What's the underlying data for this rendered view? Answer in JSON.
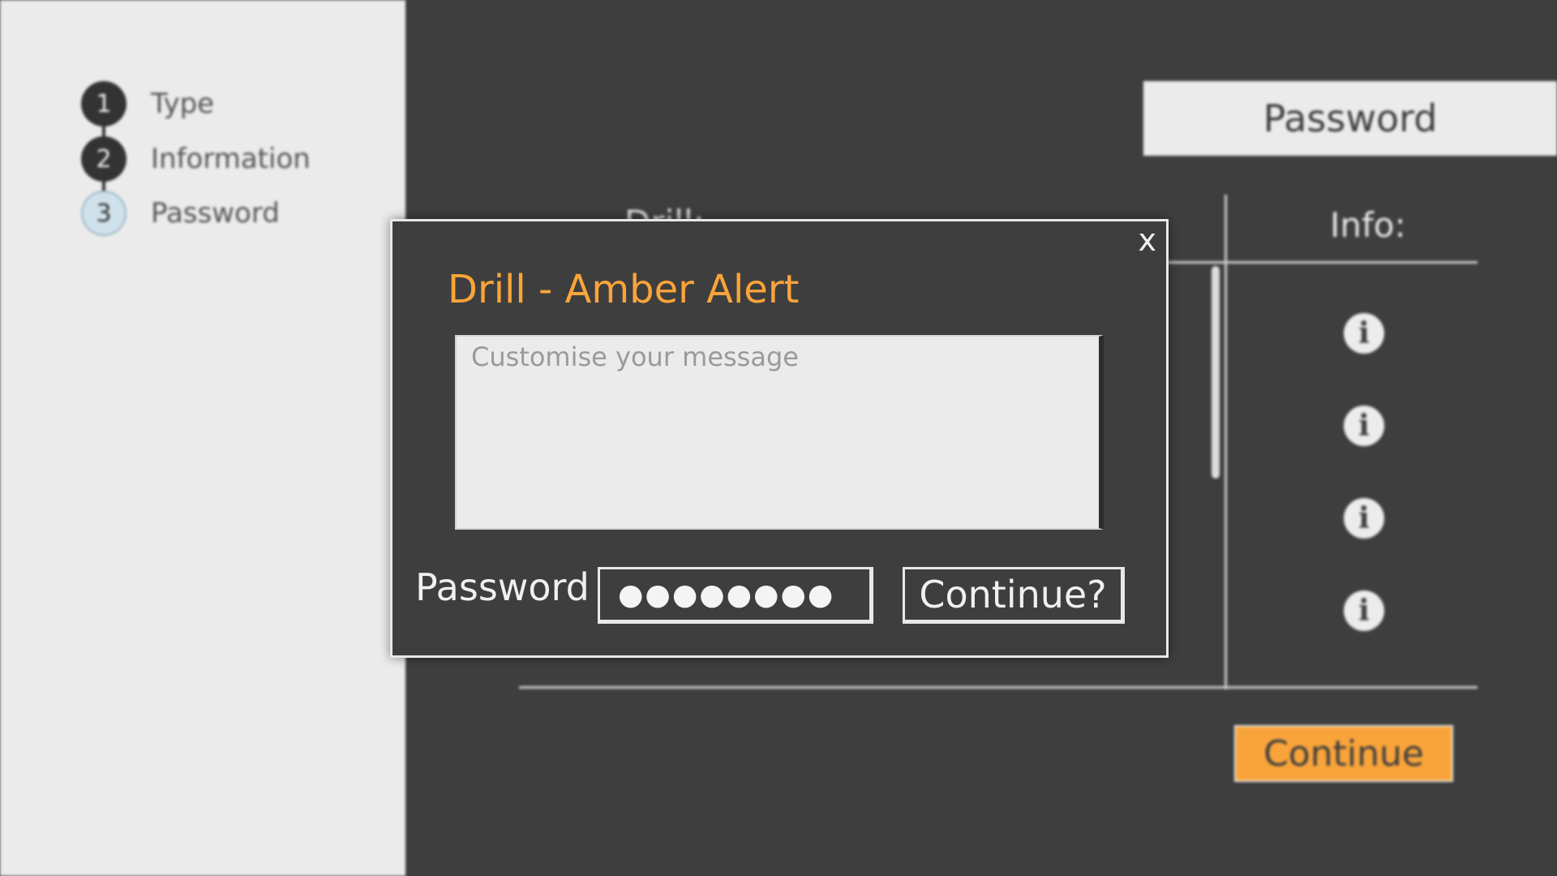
{
  "steps": [
    {
      "number": "1",
      "label": "Type",
      "state": "done"
    },
    {
      "number": "2",
      "label": "Information",
      "state": "done"
    },
    {
      "number": "3",
      "label": "Password",
      "state": "current"
    }
  ],
  "header": {
    "tab_label": "Password"
  },
  "table": {
    "left_heading": "Drill:",
    "info_heading": "Info:",
    "info_icons": [
      "info-icon",
      "info-icon",
      "info-icon",
      "info-icon"
    ]
  },
  "continue_button": {
    "label": "Continue"
  },
  "modal": {
    "close_label": "x",
    "title": "Drill - Amber Alert",
    "message_placeholder": "Customise your message",
    "password_label": "Password",
    "password_value": "●●●●●●●●",
    "submit_label": "Continue?"
  },
  "colors": {
    "accent": "#f9a43a",
    "background": "#3e3e3e",
    "panel": "#ebebeb"
  }
}
